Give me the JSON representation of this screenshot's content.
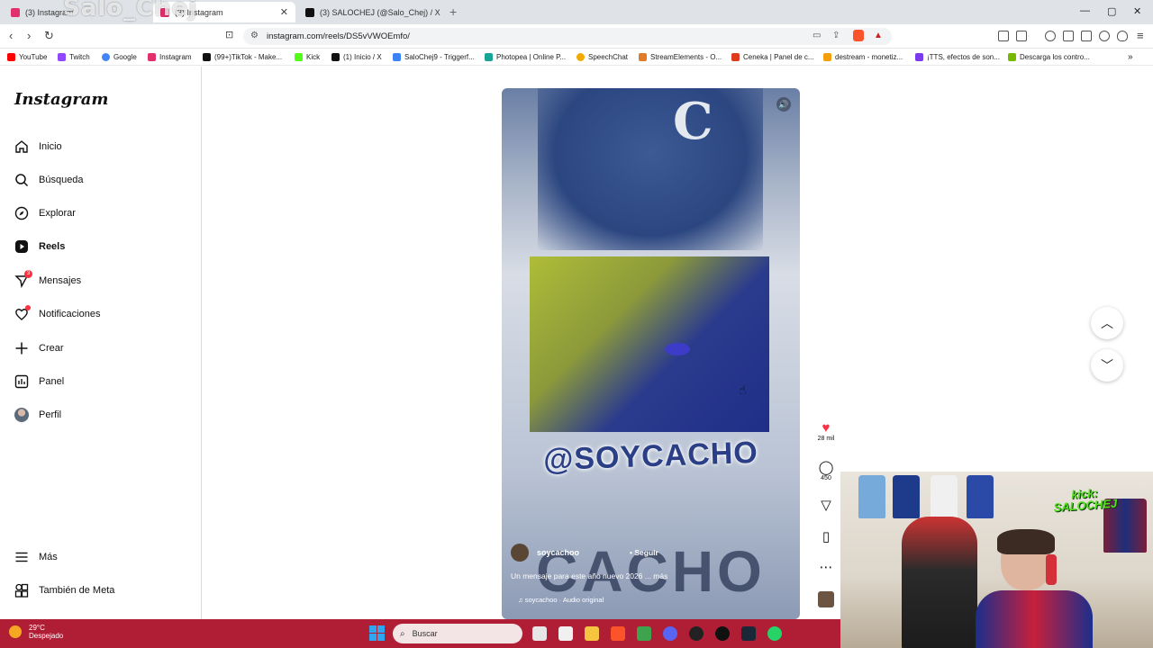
{
  "browser": {
    "tabs": [
      {
        "label": "(3) Instagram",
        "color": "#e1306c"
      },
      {
        "label": "(3) Instagram",
        "color": "#e1306c"
      },
      {
        "label": "(3) SALOCHEJ (@Salo_Chej) / X",
        "color": "#111111"
      }
    ],
    "url": "instagram.com/reels/DS5vVWOEmfo/",
    "bookmarks": [
      {
        "label": "YouTube",
        "color": "#ff0000"
      },
      {
        "label": "Twitch",
        "color": "#9146ff"
      },
      {
        "label": "Google",
        "color": "#4285f4"
      },
      {
        "label": "Instagram",
        "color": "#e1306c"
      },
      {
        "label": "(99+)TikTok - Make...",
        "color": "#111111"
      },
      {
        "label": "Kick",
        "color": "#53fc18"
      },
      {
        "label": "(1) Inicio / X",
        "color": "#111111"
      },
      {
        "label": "SaloChej9 - Triggerf...",
        "color": "#3b82f6"
      },
      {
        "label": "Photopea | Online P...",
        "color": "#18a497"
      },
      {
        "label": "SpeechChat",
        "color": "#f2a900"
      },
      {
        "label": "StreamElements - O...",
        "color": "#e07b2a"
      },
      {
        "label": "Ceneka | Panel de c...",
        "color": "#e03a1e"
      },
      {
        "label": "destream - monetiz...",
        "color": "#f59e0b"
      },
      {
        "label": "¡TTS, efectos de son...",
        "color": "#7c3aed"
      },
      {
        "label": "Descarga los contro...",
        "color": "#76b900"
      }
    ]
  },
  "watermark": "Salo_Chej",
  "instagram": {
    "logo": "Instagram",
    "nav": [
      {
        "label": "Inicio",
        "icon": "home-icon"
      },
      {
        "label": "Búsqueda",
        "icon": "search-icon"
      },
      {
        "label": "Explorar",
        "icon": "compass-icon"
      },
      {
        "label": "Reels",
        "icon": "reels-icon"
      },
      {
        "label": "Mensajes",
        "icon": "messenger-icon",
        "badge": "3"
      },
      {
        "label": "Notificaciones",
        "icon": "heart-icon"
      },
      {
        "label": "Crear",
        "icon": "plus-icon"
      },
      {
        "label": "Panel",
        "icon": "chart-icon"
      },
      {
        "label": "Perfil",
        "icon": "avatar-icon"
      }
    ],
    "more": "Más",
    "meta": "También de Meta",
    "reel": {
      "handle_overlay": "@SOYCACHO",
      "big_word": "CACHO",
      "author": "soycachoo",
      "follow": "Seguir",
      "caption": "Un mensaje para este año nuevo 2026 ... más",
      "audio": "soycachoo · Audio original"
    },
    "actions": {
      "likes": "28 mil",
      "comments": "450"
    }
  },
  "webcam": {
    "overlay_line1": "kick:",
    "overlay_line2": "SALOCHEJ"
  },
  "taskbar": {
    "temperature": "29°C",
    "weather": "Despejado",
    "search_placeholder": "Buscar"
  }
}
